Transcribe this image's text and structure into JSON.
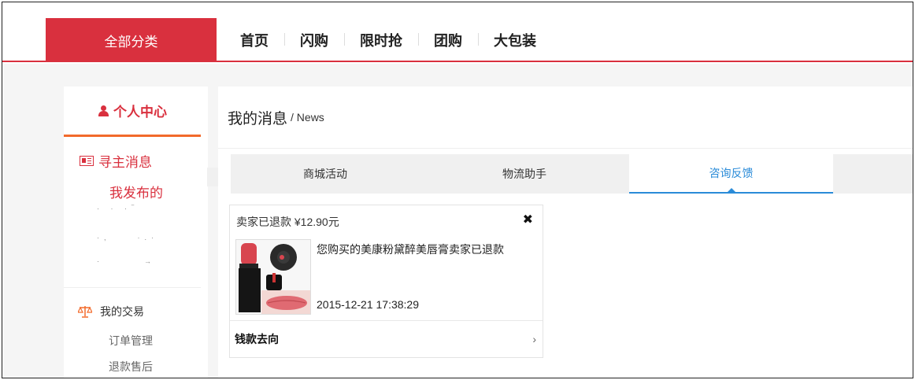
{
  "nav": {
    "all_categories": "全部分类",
    "items": [
      "首页",
      "闪购",
      "限时抢",
      "团购",
      "大包装"
    ]
  },
  "sidebar": {
    "header": "个人中心",
    "news_label": "寻主消息",
    "my_published": "我发布的",
    "trade_label": "我的交易",
    "trade_items": [
      "订单管理",
      "退款售后"
    ]
  },
  "main": {
    "title": "我的消息",
    "title_sub": "/ News",
    "tabs": [
      "商城活动",
      "物流助手",
      "咨询反馈"
    ],
    "active_tab": "咨询反馈"
  },
  "message_card": {
    "header": "卖家已退款 ¥12.90元",
    "body": "您购买的美康粉黛醉美唇膏卖家已退款",
    "time": "2015-12-21 17:38:29",
    "footer_label": "钱款去向"
  },
  "colors": {
    "brand_red": "#d9303e",
    "accent_orange": "#f26a2b",
    "tab_active_blue": "#2a8bd8"
  }
}
